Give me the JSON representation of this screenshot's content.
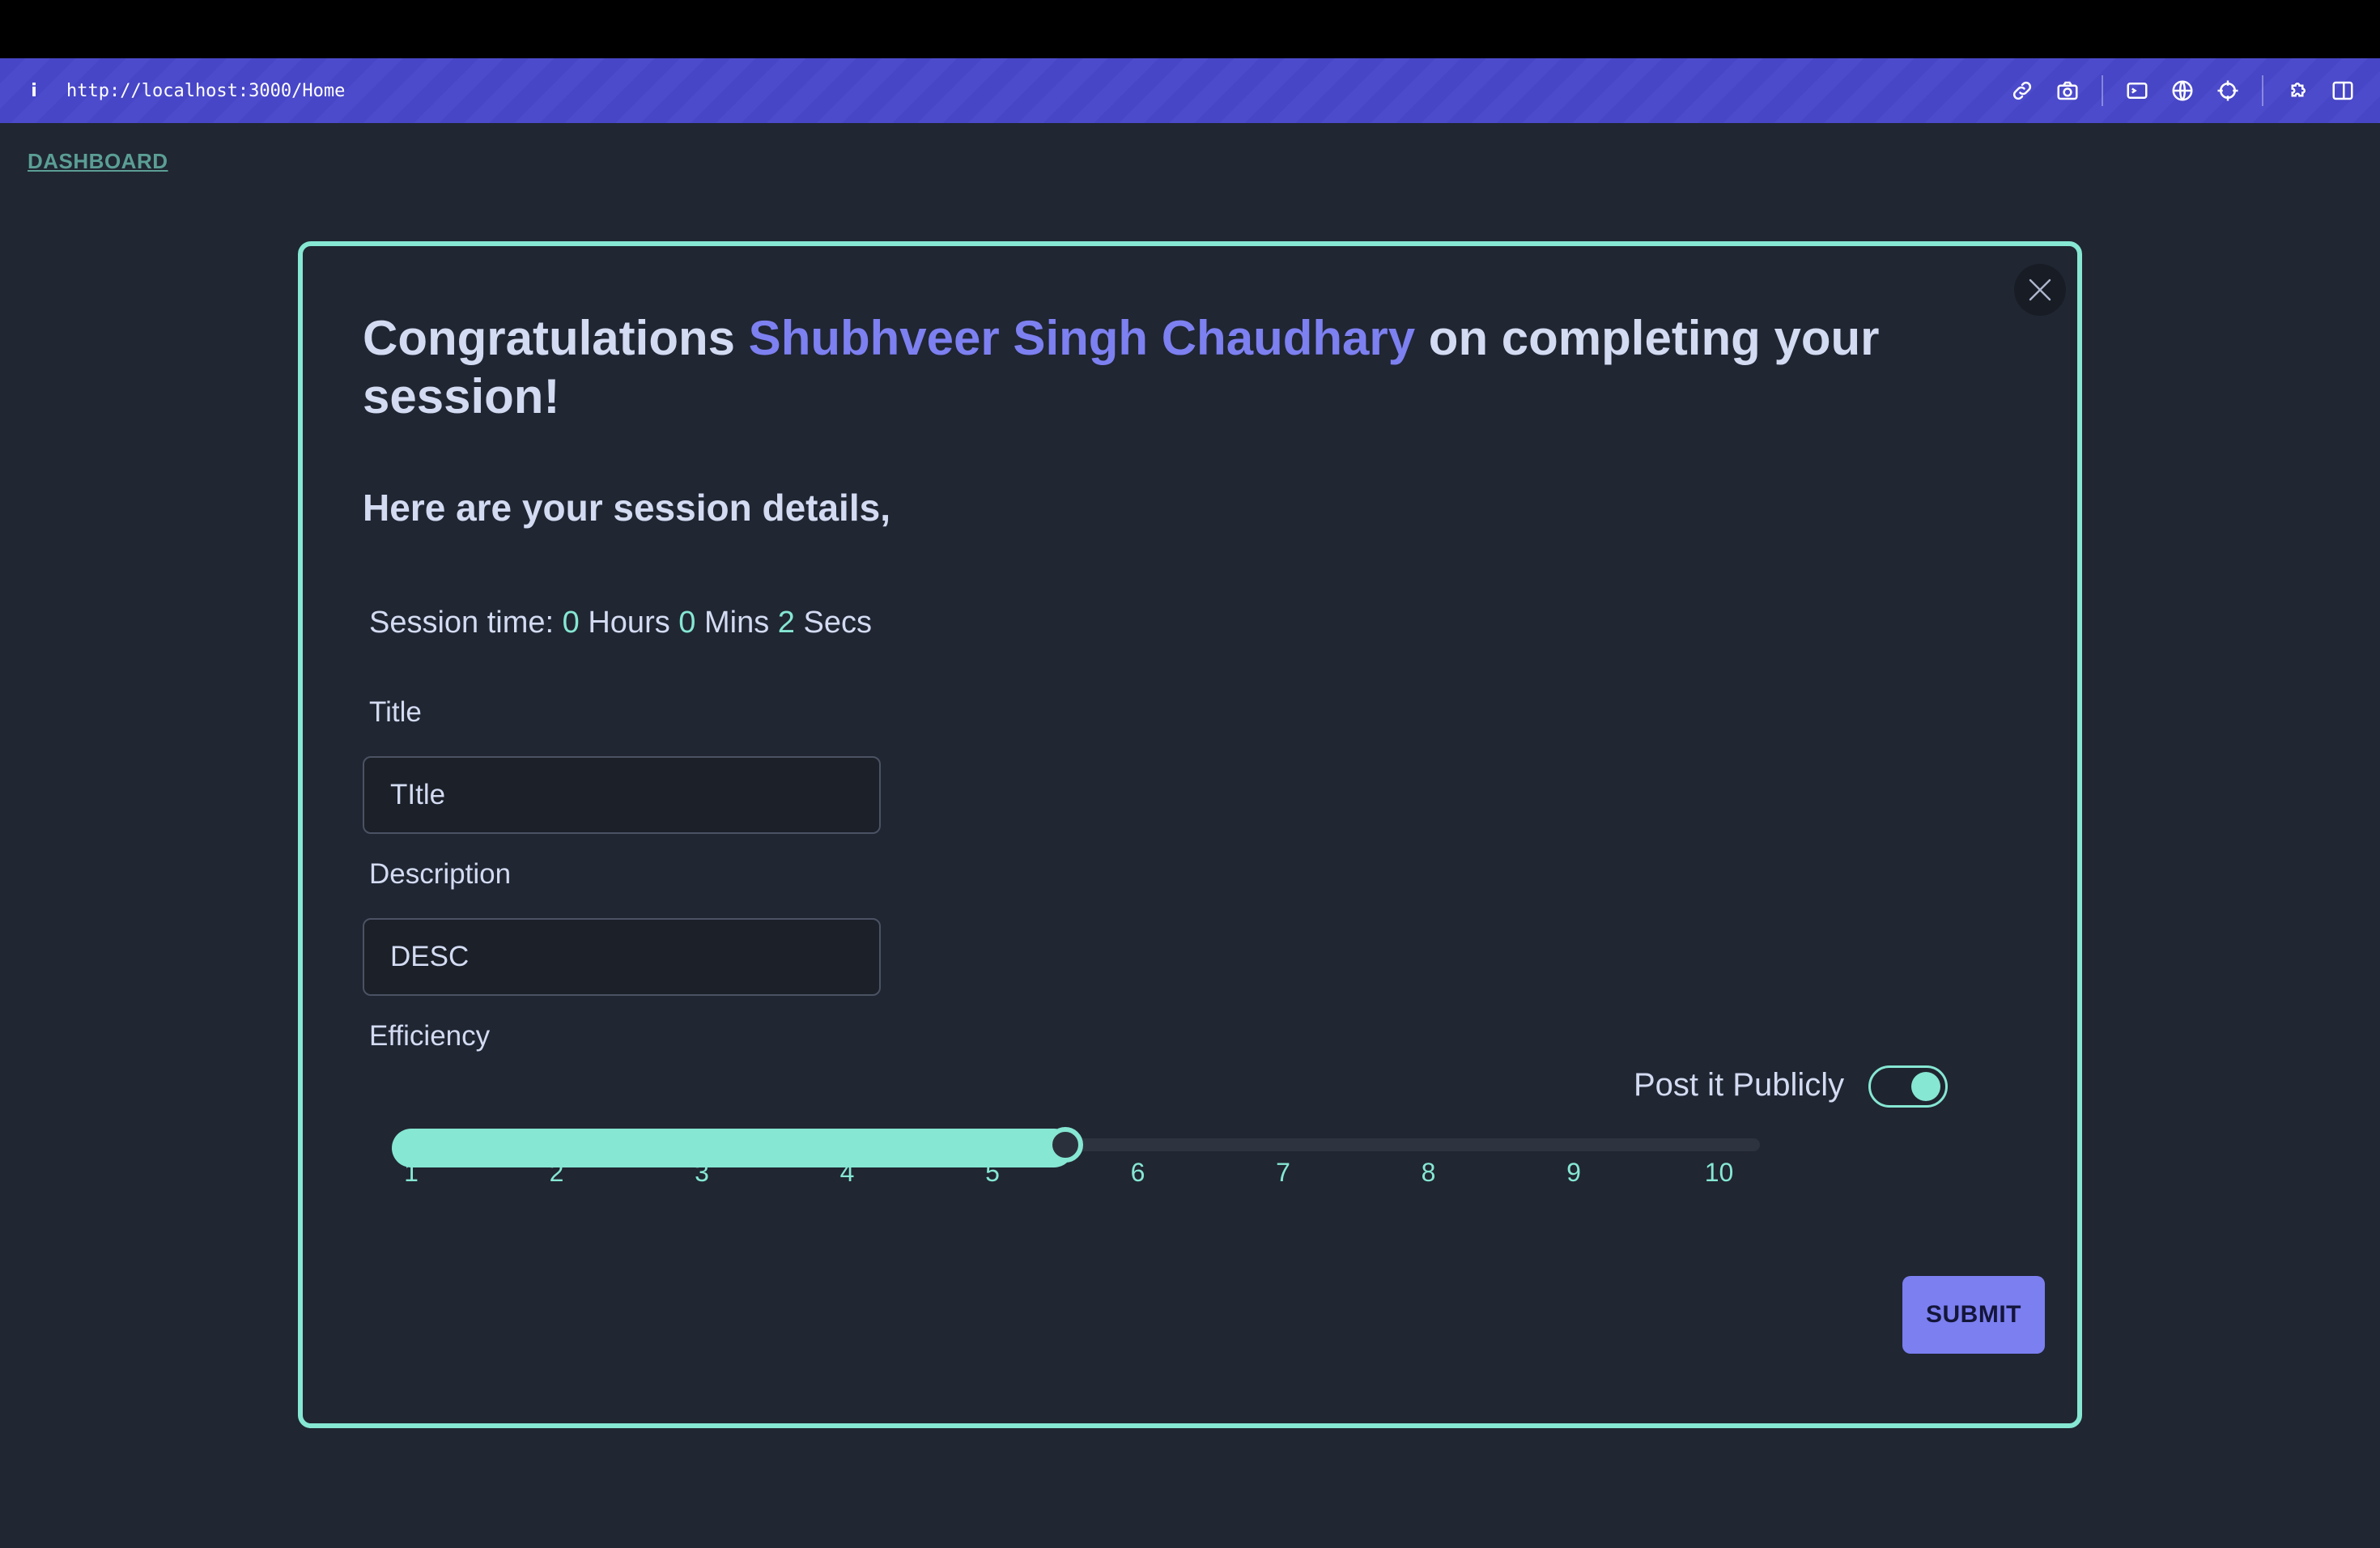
{
  "browser": {
    "info_glyph": "i",
    "url": "http://localhost:3000/Home",
    "toolbar_icons": [
      "link-icon",
      "camera-icon",
      "terminal-icon",
      "globe-icon",
      "crosshair-icon",
      "extension-icon",
      "split-view-icon"
    ]
  },
  "nav": {
    "dashboard_label": "DASHBOARD"
  },
  "modal": {
    "headline": {
      "prefix": "Congratulations ",
      "name": "Shubhveer Singh Chaudhary",
      "suffix": " on completing your session!"
    },
    "subheading": "Here are your session details,",
    "session_time": {
      "label": "Session time: ",
      "hours": "0",
      "hours_unit": " Hours ",
      "mins": "0",
      "mins_unit": " Mins ",
      "secs": "2",
      "secs_unit": " Secs"
    },
    "title_field": {
      "label": "Title",
      "value": "TItle"
    },
    "description_field": {
      "label": "Description",
      "value": "DESC"
    },
    "efficiency": {
      "label": "Efficiency",
      "min": 1,
      "max": 10,
      "value": 5.5,
      "ticks": [
        "1",
        "2",
        "3",
        "4",
        "5",
        "6",
        "7",
        "8",
        "9",
        "10"
      ]
    },
    "public_toggle": {
      "label": "Post it Publicly",
      "on": true
    },
    "submit_label": "SUBMIT"
  },
  "colors": {
    "accent_teal": "#86e7d3",
    "accent_purple": "#7d80f0",
    "background": "#202632",
    "urlbar": "#4746c6"
  }
}
